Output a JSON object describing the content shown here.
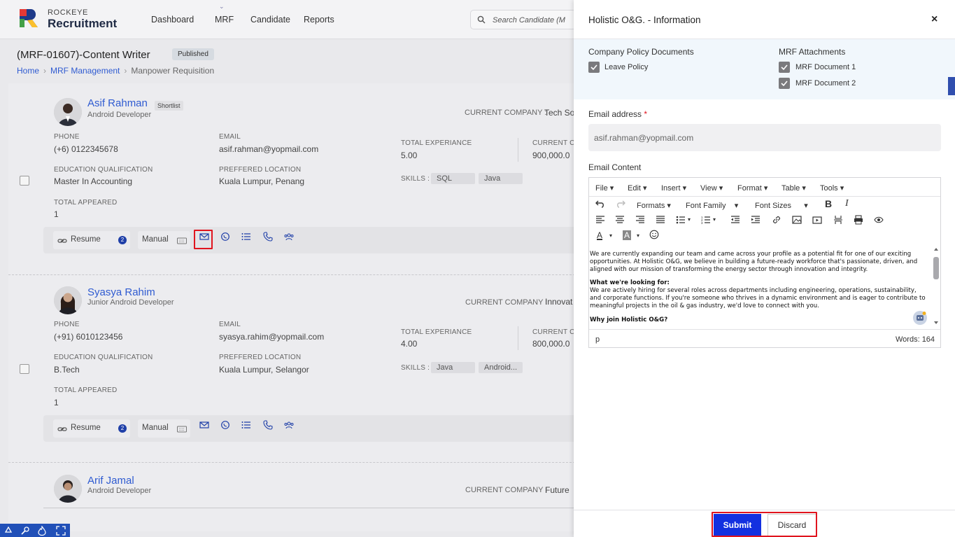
{
  "header": {
    "brand_top": "ROCKEYE",
    "brand_main": "Recruitment",
    "nav": [
      "Dashboard",
      "MRF",
      "Candidate",
      "Reports"
    ],
    "search_placeholder": "Search Candidate (M"
  },
  "page": {
    "title": "(MRF-01607)-Content Writer",
    "status": "Published",
    "breadcrumb": [
      "Home",
      "MRF Management",
      "Manpower Requisition"
    ]
  },
  "labels": {
    "phone": "PHONE",
    "email": "EMAIL",
    "total_experience": "TOTAL EXPERIANCE",
    "current_ctc": "CURRENT CT",
    "education": "EDUCATION QUALIFICATION",
    "location": "PREFFERED LOCATION",
    "skills": "SKILLS :",
    "total_appeared": "TOTAL APPEARED",
    "current_company": "CURRENT COMPANY :",
    "resume": "Resume",
    "manual": "Manual"
  },
  "candidates": [
    {
      "name": "Asif Rahman",
      "tag": "Shortlist",
      "role": "Android Developer",
      "company": "Tech So",
      "phone": "(+6) 0122345678",
      "email": "asif.rahman@yopmail.com",
      "experience": "5.00",
      "ctc": "900,000.0",
      "education": "Master In Accounting",
      "location": "Kuala Lumpur, Penang",
      "skills": [
        "SQL",
        "Java"
      ],
      "appeared": "1",
      "resume_count": "2"
    },
    {
      "name": "Syasya Rahim",
      "tag": "",
      "role": "Junior Android Developer",
      "company": "Innovat",
      "phone": "(+91) 6010123456",
      "email": "syasya.rahim@yopmail.com",
      "experience": "4.00",
      "ctc": "800,000.0",
      "education": "B.Tech",
      "location": "Kuala Lumpur, Selangor",
      "skills": [
        "Java",
        "Android..."
      ],
      "appeared": "1",
      "resume_count": "2"
    },
    {
      "name": "Arif Jamal",
      "role": "Android Developer",
      "company": "Future"
    }
  ],
  "drawer": {
    "title": "Holistic O&G. - Information",
    "close": "×",
    "policy_heading": "Company Policy Documents",
    "policy_docs": [
      "Leave Policy"
    ],
    "attach_heading": "MRF Attachments",
    "attach_docs": [
      "MRF Document 1",
      "MRF Document 2"
    ],
    "email_label": "Email address",
    "email_required": "*",
    "email_value": "asif.rahman@yopmail.com",
    "content_label": "Email Content",
    "submit": "Submit",
    "discard": "Discard"
  },
  "editor": {
    "menus": [
      "File",
      "Edit",
      "Insert",
      "View",
      "Format",
      "Table",
      "Tools"
    ],
    "formats": "Formats",
    "font_family": "Font Family",
    "font_sizes": "Font Sizes",
    "para1": "We are currently expanding our team and came across your profile as a potential fit for one of our exciting opportunities. At Holistic O&G, we believe in building a future-ready workforce that's passionate, driven, and aligned with our mission of transforming the energy sector through innovation and integrity.",
    "heading2": "What we're looking for:",
    "para2": "We are actively hiring for several roles across departments including engineering, operations, sustainability, and corporate functions. If you're someone who thrives in a dynamic environment and is eager to contribute to meaningful projects in the oil & gas industry, we'd love to connect with you.",
    "heading3": "Why join Holistic O&G?",
    "path": "p",
    "words": "Words: 164"
  },
  "colors": {
    "accent": "#2f5bd1",
    "primary_button": "#1330e0",
    "highlight": "#e0141e"
  }
}
